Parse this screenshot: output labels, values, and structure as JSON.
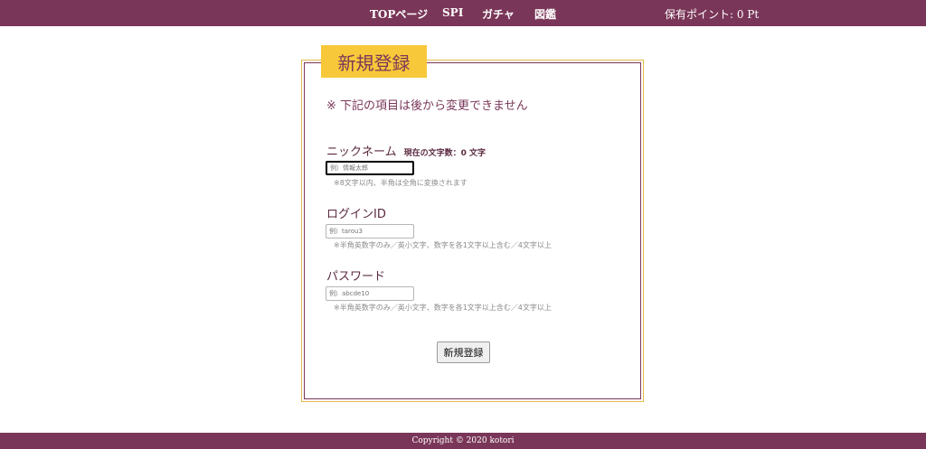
{
  "header": {
    "nav": [
      {
        "label": "TOPページ"
      },
      {
        "label": "SPI"
      },
      {
        "label": "ガチャ"
      },
      {
        "label": "図鑑"
      }
    ],
    "points_text": "保有ポイント: 0 Pt"
  },
  "form": {
    "title": "新規登録",
    "notice": "※ 下記の項目は後から変更できません",
    "nickname": {
      "label": "ニックネーム",
      "char_count": "現在の文字数：0 文字",
      "placeholder": "例）情報太郎",
      "value": "",
      "hint": "※8文字以内、半角は全角に変換されます"
    },
    "login_id": {
      "label": "ログインID",
      "placeholder": "例）tarou3",
      "value": "",
      "hint": "※半角英数字のみ／英小文字、数字を各1文字以上含む／4文字以上"
    },
    "password": {
      "label": "パスワード",
      "placeholder": "例）abcde10",
      "value": "",
      "hint": "※半角英数字のみ／英小文字、数字を各1文字以上含む／4文字以上"
    },
    "submit_label": "新規登録"
  },
  "footer": {
    "copyright": "Copyright © 2020 kotori"
  },
  "colors": {
    "header_bg": "#7a3658",
    "title_bg": "#f7c83a",
    "frame_gold": "#e3b94a"
  }
}
